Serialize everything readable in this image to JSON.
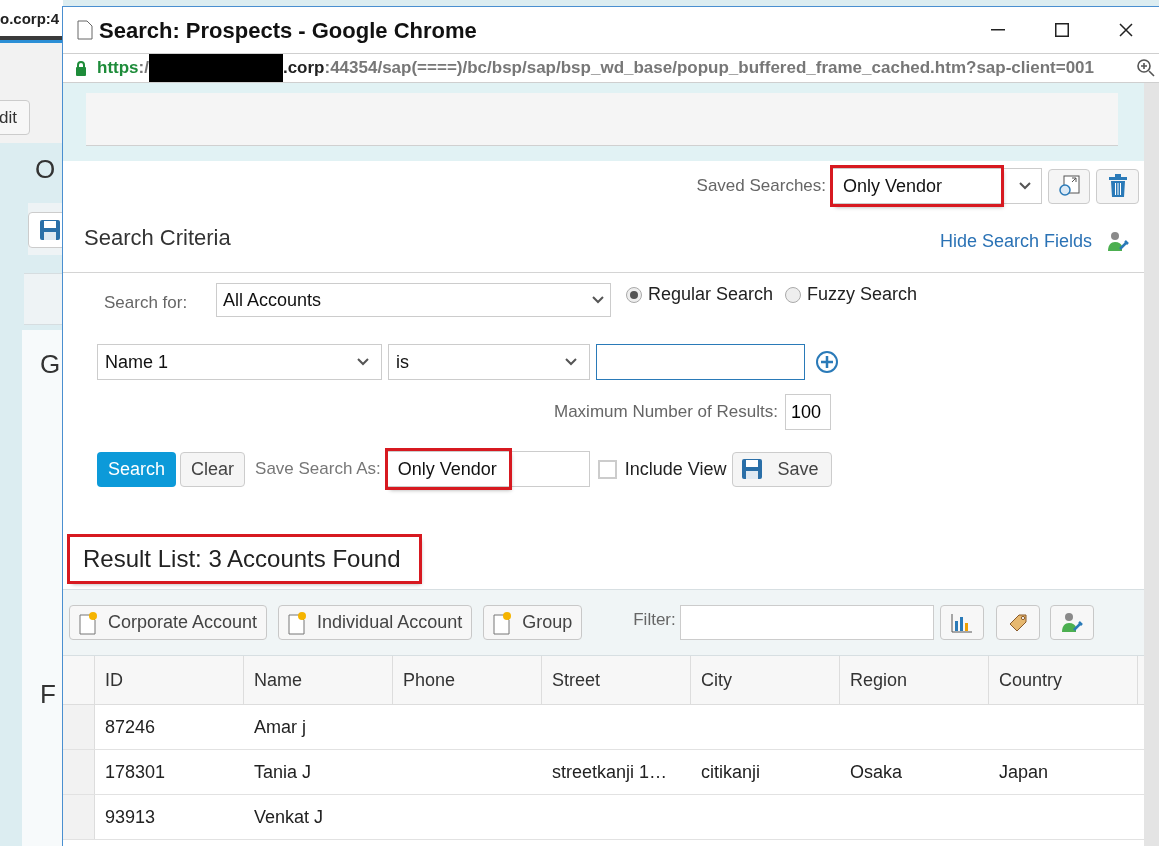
{
  "background_page": {
    "url_fragment": "o.corp:4",
    "button": "dit",
    "texts": [
      "O",
      "G",
      "F"
    ]
  },
  "window": {
    "title": "Search: Prospects - Google Chrome"
  },
  "address_bar": {
    "scheme": "https",
    "after_scheme": ":/",
    "redacted": true,
    "host": ".corp",
    "path": ":44354/sap(====)/bc/bsp/sap/bsp_wd_base/popup_buffered_frame_cached.htm?sap-client=001"
  },
  "saved_searches": {
    "label": "Saved Searches:",
    "value": "Only Vendor",
    "highlighted": true
  },
  "search_criteria": {
    "title": "Search Criteria",
    "hide_link": "Hide Search Fields",
    "search_for": {
      "label": "Search for:",
      "value": "All Accounts"
    },
    "search_modes": [
      {
        "label": "Regular Search",
        "selected": true
      },
      {
        "label": "Fuzzy Search",
        "selected": false
      }
    ],
    "criteria_row": {
      "field": "Name 1",
      "operator": "is"
    },
    "max_results": {
      "label": "Maximum Number of Results:",
      "value": "100"
    },
    "search_button": "Search",
    "clear_button": "Clear",
    "save_as": {
      "label": "Save Search As:",
      "value": "Only Vendor",
      "highlighted": true
    },
    "include_view": {
      "label": "Include View",
      "checked": false
    },
    "save_button": "Save"
  },
  "results": {
    "title": "Result List: 3 Accounts Found",
    "highlighted": true,
    "new_buttons": [
      "Corporate Account",
      "Individual Account",
      "Group"
    ],
    "filter_label": "Filter:",
    "columns": [
      "ID",
      "Name",
      "Phone",
      "Street",
      "City",
      "Region",
      "Country"
    ],
    "rows": [
      {
        "id": "87246",
        "name": "Amar j"
      },
      {
        "id": "178301",
        "name": "Tania J",
        "street": "streetkanji 1…",
        "city": "citikanji",
        "region": "Osaka",
        "country": "Japan"
      },
      {
        "id": "93913",
        "name": "Venkat J"
      }
    ]
  }
}
